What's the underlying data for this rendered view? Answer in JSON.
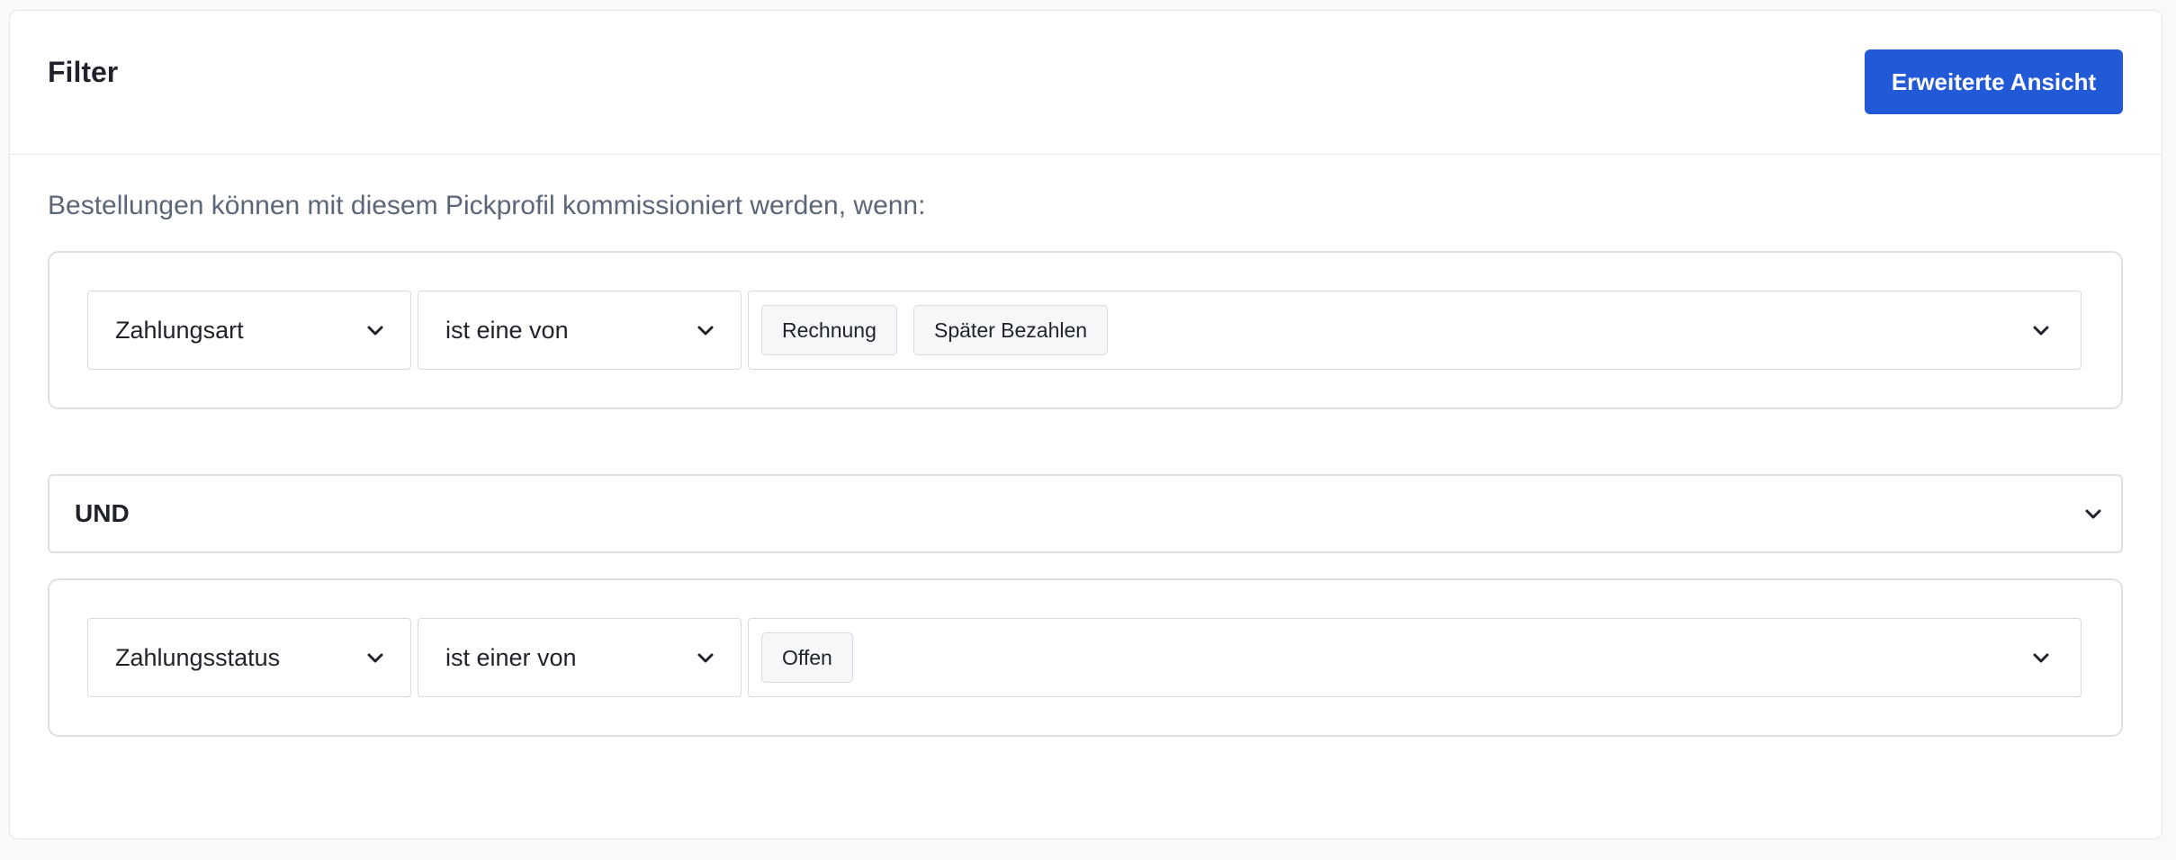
{
  "header": {
    "title": "Filter",
    "advanced_view_label": "Erweiterte Ansicht"
  },
  "description": "Bestellungen können mit diesem Pickprofil kommissioniert werden, wenn:",
  "groups": [
    {
      "field": "Zahlungsart",
      "operator": "ist eine von",
      "values": [
        "Rechnung",
        "Später Bezahlen"
      ]
    },
    {
      "field": "Zahlungsstatus",
      "operator": "ist einer von",
      "values": [
        "Offen"
      ]
    }
  ],
  "connector": "UND",
  "colors": {
    "primary": "#2159d6",
    "border": "#dde0e5",
    "muted_text": "#5b6678"
  },
  "icons": {
    "dropdown": "chevron-down-icon"
  }
}
